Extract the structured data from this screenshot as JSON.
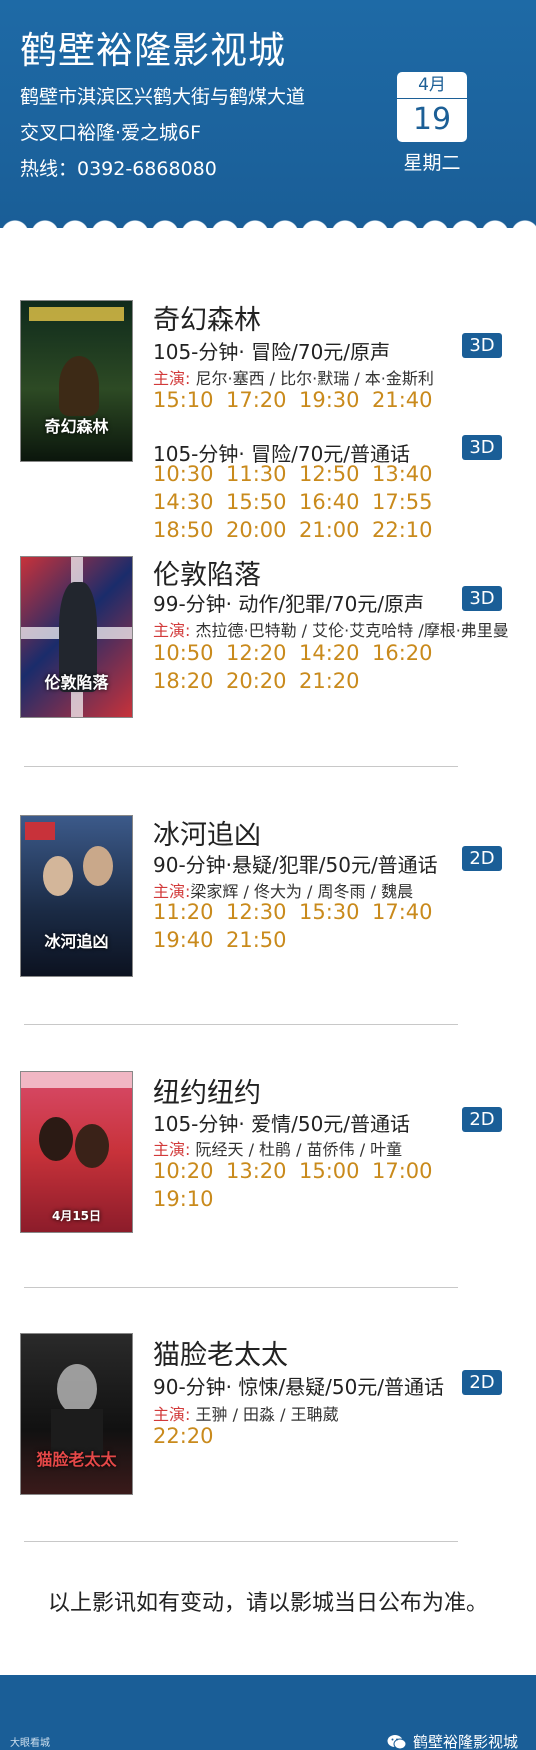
{
  "header": {
    "cinema_name": "鹤壁裕隆影视城",
    "address_line1": "鹤壁市淇滨区兴鹤大街与鹤煤大道",
    "address_line2": "交叉口裕隆·爱之城6F",
    "hotline": "热线：0392-6868080",
    "month": "4月",
    "day": "19",
    "weekday": "星期二"
  },
  "movies": [
    {
      "title": "奇幻森林",
      "poster_title": "奇幻森林",
      "sessions": [
        {
          "info": "105-分钟·  冒险/70元/原声",
          "format": "3D",
          "cast_label": "主演:",
          "cast": " 尼尔·塞西 / 比尔·默瑞 / 本·金斯利",
          "times": [
            [
              "15:10",
              "17:20",
              "19:30",
              "21:40"
            ]
          ]
        },
        {
          "info": "105-分钟·  冒险/70元/普通话",
          "format": "3D",
          "times": [
            [
              "10:30",
              "11:30",
              "12:50",
              "13:40"
            ],
            [
              "14:30",
              "15:50",
              "16:40",
              "17:55"
            ],
            [
              "18:50",
              "20:00",
              "21:00",
              "22:10"
            ]
          ]
        }
      ]
    },
    {
      "title": "伦敦陷落",
      "poster_title": "伦敦陷落",
      "info": "99-分钟·  动作/犯罪/70元/原声",
      "format": "3D",
      "cast_label": "主演:",
      "cast": " 杰拉德·巴特勒 / 艾伦·艾克哈特 /摩根·弗里曼",
      "times": [
        [
          "10:50",
          "12:20",
          "14:20",
          "16:20"
        ],
        [
          "18:20",
          "20:20",
          "21:20"
        ]
      ]
    },
    {
      "title": "冰河追凶",
      "poster_title": "冰河追凶",
      "info": "90-分钟·悬疑/犯罪/50元/普通话",
      "format": "2D",
      "cast_label": "主演:",
      "cast": "梁家辉 / 佟大为 / 周冬雨 / 魏晨",
      "times": [
        [
          "11:20",
          "12:30",
          "15:30",
          "17:40"
        ],
        [
          "19:40",
          "21:50"
        ]
      ]
    },
    {
      "title": "纽约纽约",
      "poster_title": "4月15日",
      "info": "105-分钟· 爱情/50元/普通话",
      "format": "2D",
      "cast_label": "主演:",
      "cast": " 阮经天 / 杜鹃 / 苗侨伟 / 叶童",
      "times": [
        [
          "10:20",
          "13:20",
          "15:00",
          "17:00"
        ],
        [
          "19:10"
        ]
      ]
    },
    {
      "title": "猫脸老太太",
      "poster_title": "猫脸老太太",
      "info": "90-分钟· 惊悚/悬疑/50元/普通话",
      "format": "2D",
      "cast_label": "主演:",
      "cast": " 王翀 / 田淼 / 王聃葳",
      "times": [
        [
          "22:20"
        ]
      ]
    }
  ],
  "note": "以上影讯如有变动，请以影城当日公布为准。",
  "footer": {
    "brand": "鹤壁裕隆影视城",
    "watermark": "大眼看城"
  },
  "colors": {
    "header_blue": "#1a5e97",
    "time_orange": "#c98a1c",
    "cast_red": "#d23a3a"
  }
}
